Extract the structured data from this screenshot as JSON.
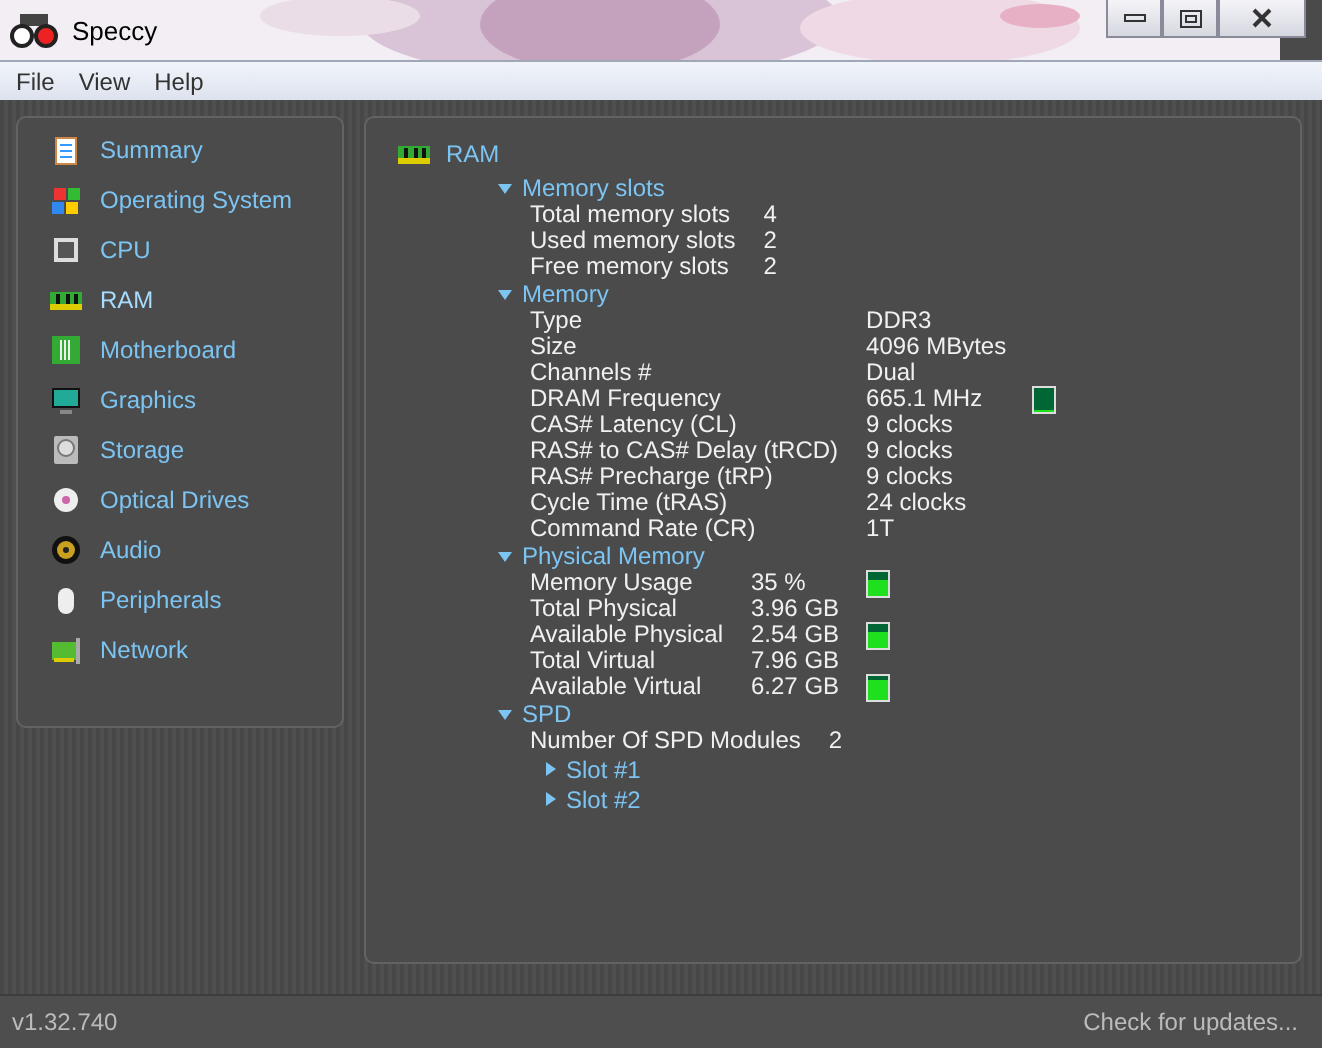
{
  "window": {
    "title": "Speccy"
  },
  "menu": [
    "File",
    "View",
    "Help"
  ],
  "sidebar": {
    "items": [
      {
        "label": "Summary",
        "selected": false
      },
      {
        "label": "Operating System",
        "selected": false
      },
      {
        "label": "CPU",
        "selected": false
      },
      {
        "label": "RAM",
        "selected": true
      },
      {
        "label": "Motherboard",
        "selected": false
      },
      {
        "label": "Graphics",
        "selected": false
      },
      {
        "label": "Storage",
        "selected": false
      },
      {
        "label": "Optical Drives",
        "selected": false
      },
      {
        "label": "Audio",
        "selected": false
      },
      {
        "label": "Peripherals",
        "selected": false
      },
      {
        "label": "Network",
        "selected": false
      }
    ]
  },
  "content": {
    "title": "RAM",
    "sections": [
      {
        "title": "Memory slots",
        "expanded": true,
        "rows": [
          {
            "label": "Total memory slots",
            "value": "4"
          },
          {
            "label": "Used memory slots",
            "value": "2"
          },
          {
            "label": "Free memory slots",
            "value": "2"
          }
        ]
      },
      {
        "title": "Memory",
        "expanded": true,
        "rows": [
          {
            "label": "Type",
            "value": "DDR3"
          },
          {
            "label": "Size",
            "value": "4096 MBytes"
          },
          {
            "label": "Channels #",
            "value": "Dual"
          },
          {
            "label": "DRAM Frequency",
            "value": "665.1 MHz",
            "meter": {
              "level": 0.05
            }
          },
          {
            "label": "CAS# Latency (CL)",
            "value": "9 clocks"
          },
          {
            "label": "RAS# to CAS# Delay (tRCD)",
            "value": "9 clocks"
          },
          {
            "label": "RAS# Precharge (tRP)",
            "value": "9 clocks"
          },
          {
            "label": "Cycle Time (tRAS)",
            "value": "24 clocks"
          },
          {
            "label": "Command Rate (CR)",
            "value": "1T"
          }
        ]
      },
      {
        "title": "Physical Memory",
        "expanded": true,
        "rows": [
          {
            "label": "Memory Usage",
            "value": "35 %",
            "meter": {
              "level": 0.65
            }
          },
          {
            "label": "Total Physical",
            "value": "3.96 GB"
          },
          {
            "label": "Available Physical",
            "value": "2.54 GB",
            "meter": {
              "level": 0.65
            }
          },
          {
            "label": "Total Virtual",
            "value": "7.96 GB"
          },
          {
            "label": "Available Virtual",
            "value": "6.27 GB",
            "meter": {
              "level": 0.8
            }
          }
        ]
      },
      {
        "title": "SPD",
        "expanded": true,
        "rows": [
          {
            "label": "Number Of SPD Modules",
            "value": "2"
          }
        ],
        "children": [
          {
            "title": "Slot #1",
            "expanded": false
          },
          {
            "title": "Slot #2",
            "expanded": false
          }
        ]
      }
    ]
  },
  "status": {
    "version": "v1.32.740",
    "link": "Check for updates..."
  }
}
